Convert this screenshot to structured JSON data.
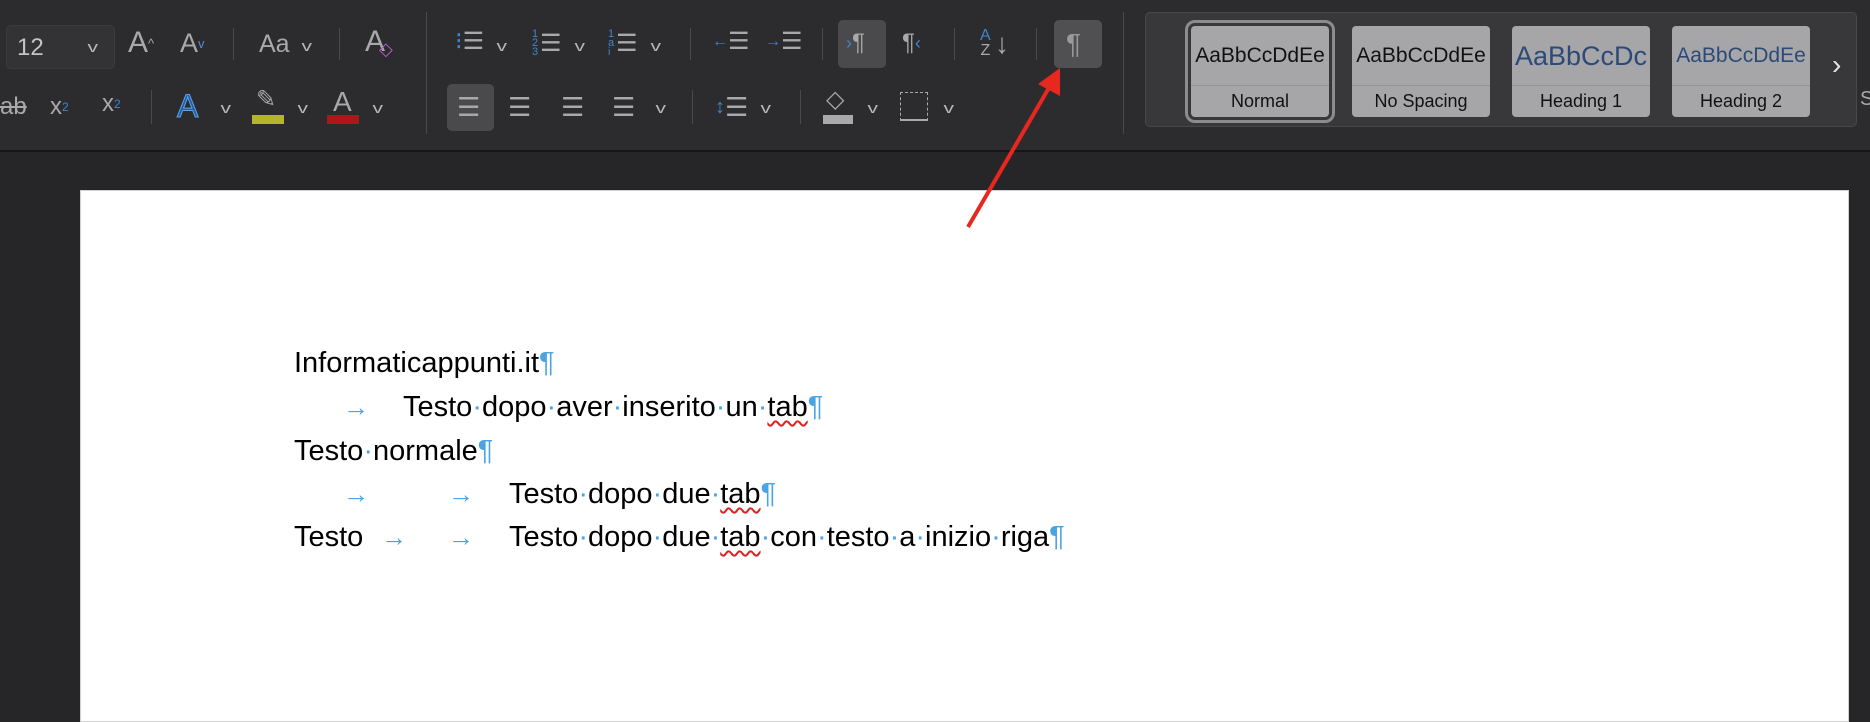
{
  "toolbar": {
    "font_size": "12",
    "icons": [
      "grow-font-icon",
      "shrink-font-icon",
      "change-case-icon",
      "clear-formatting-icon",
      "bullets-icon",
      "numbering-icon",
      "multilevel-list-icon",
      "decrease-indent-icon",
      "increase-indent-icon",
      "ltr-paragraph-icon",
      "rtl-paragraph-icon",
      "sort-icon",
      "show-formatting-marks-icon",
      "strikethrough-icon",
      "subscript-icon",
      "superscript-icon",
      "text-effects-icon",
      "highlight-icon",
      "font-color-icon",
      "align-left-icon",
      "align-center-icon",
      "align-right-icon",
      "justify-icon",
      "line-spacing-icon",
      "shading-icon",
      "borders-icon"
    ],
    "highlight_color": "#b5b52a",
    "font_color": "#b3141b",
    "show_marks_active": true
  },
  "styles": {
    "items": [
      {
        "preview": "AaBbCcDdEe",
        "label": "Normal",
        "color": "#111111"
      },
      {
        "preview": "AaBbCcDdEe",
        "label": "No Spacing",
        "color": "#111111"
      },
      {
        "preview": "AaBbCcDc",
        "label": "Heading 1",
        "color": "#2c4a78"
      },
      {
        "preview": "AaBbCcDdEe",
        "label": "Heading 2",
        "color": "#2c4a78"
      }
    ],
    "next_label": "›",
    "partial_label": "S"
  },
  "document": {
    "lines": [
      {
        "text": "Informaticappunti.it",
        "tabs": 0
      },
      {
        "text": "Testo dopo aver inserito un tab",
        "tabs": 1
      },
      {
        "text": "Testo normale",
        "tabs": 0
      },
      {
        "text": "Testo dopo due tab",
        "tabs": 2
      },
      {
        "prefix": "Testo",
        "text": "Testo dopo due tab con testo a inizio riga",
        "tabs": 2
      }
    ],
    "misspelled": [
      "tab"
    ],
    "paragraph_mark": "¶",
    "tab_mark": "→",
    "space_mark": "·",
    "mark_color": "#4aa3e3"
  },
  "annotation": {
    "color": "#e8281e"
  }
}
